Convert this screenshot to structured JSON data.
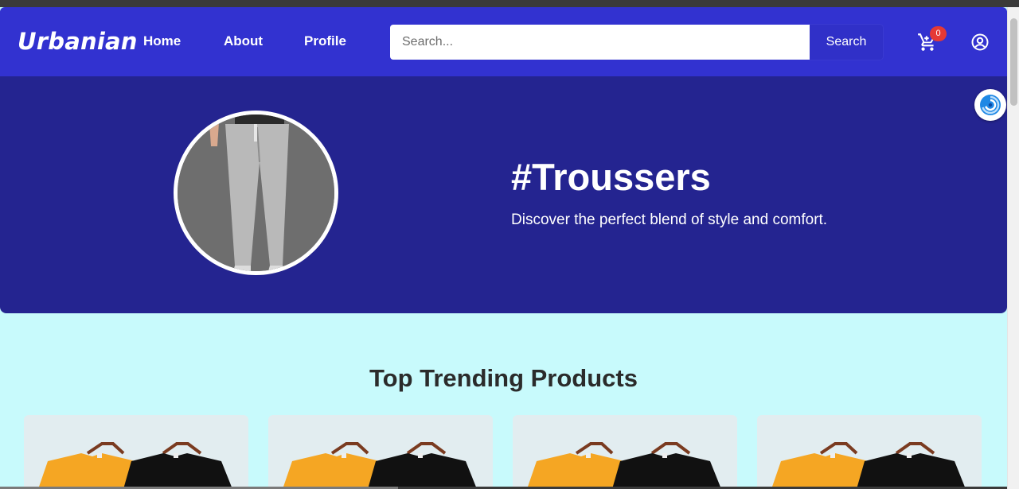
{
  "navbar": {
    "brand": "Urbanian",
    "links": [
      "Home",
      "About",
      "Profile"
    ],
    "search": {
      "placeholder": "Search...",
      "value": "",
      "button_label": "Search"
    },
    "cart": {
      "icon": "cart-icon",
      "count": "0"
    },
    "account_icon": "account-circle-icon",
    "colors": {
      "background": "#3232d0",
      "badge": "#e53935"
    }
  },
  "hero": {
    "title": "#Troussers",
    "subtitle": "Discover the perfect blend of style and comfort.",
    "image": "trousers-photo",
    "colors": {
      "background": "#242490"
    }
  },
  "extension_icon": "spiral-extension-icon",
  "products_section": {
    "title": "Top Trending Products",
    "cards": [
      {
        "image": "tshirts-on-hangers-photo"
      },
      {
        "image": "tshirts-on-hangers-photo"
      },
      {
        "image": "tshirts-on-hangers-photo"
      },
      {
        "image": "tshirts-on-hangers-photo"
      }
    ],
    "colors": {
      "page_background": "#c8fafc",
      "card_background": "#e2edf0"
    }
  }
}
